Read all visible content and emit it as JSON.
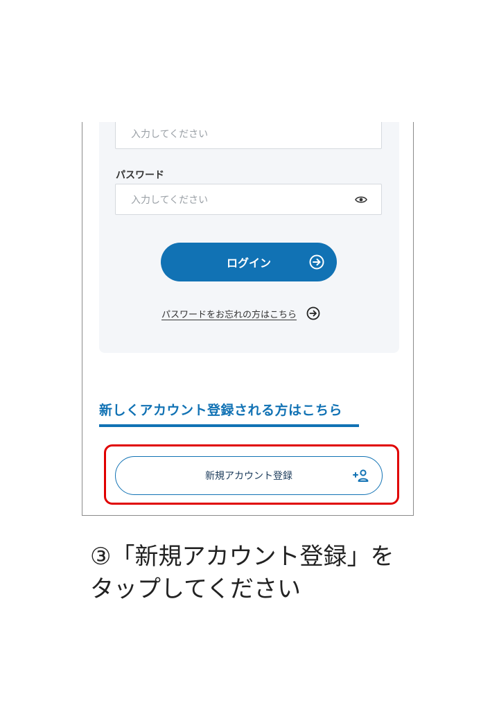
{
  "form": {
    "email_placeholder": "入力してください",
    "password_label": "パスワード",
    "password_placeholder": "入力してください",
    "login_label": "ログイン",
    "forgot_label": "パスワードをお忘れの方はこちら"
  },
  "register": {
    "heading": "新しくアカウント登録される方はこちら",
    "button_label": "新規アカウント登録"
  },
  "caption": {
    "line1": "③「新規アカウント登録」を",
    "line2": "タップしてください"
  },
  "colors": {
    "primary": "#1172b4",
    "highlight": "#e00000",
    "panel": "#f4f6f9"
  },
  "icons": [
    "eye-icon",
    "arrow-right-circle-icon",
    "add-user-icon"
  ]
}
